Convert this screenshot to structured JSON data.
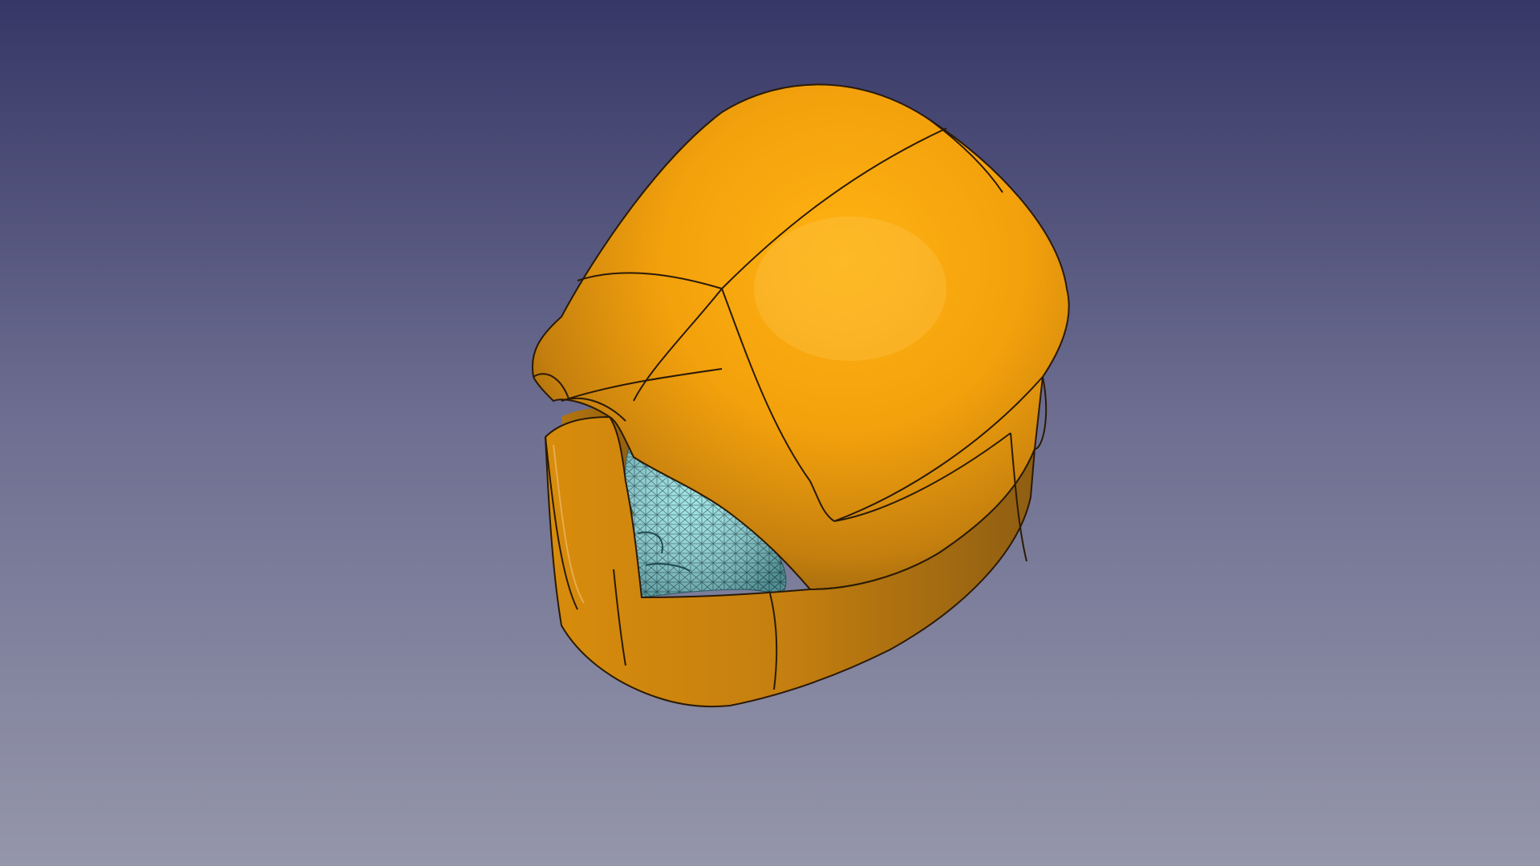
{
  "viewport": {
    "background_top": "#363766",
    "background_bottom": "#9596aa"
  },
  "model": {
    "shell_color": "#ffa70d",
    "shell_shadow_color": "#9a6411",
    "edge_color": "#2a1a05",
    "mesh_color": "#8fe0e2",
    "mesh_line_color": "#2c5d63"
  }
}
